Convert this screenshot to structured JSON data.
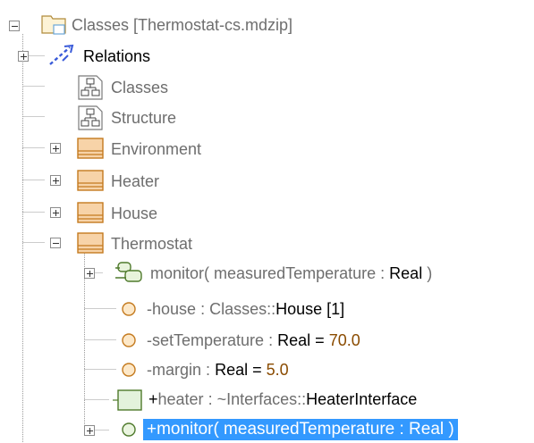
{
  "tree": {
    "root": {
      "label": "Classes [Thermostat-cs.mdzip]",
      "icon": "package-icon"
    },
    "items": [
      {
        "label": "Relations",
        "icon": "relations-icon"
      },
      {
        "label": "Classes",
        "icon": "class-diagram-icon"
      },
      {
        "label": "Structure",
        "icon": "class-diagram-icon"
      },
      {
        "label": "Environment",
        "icon": "class-icon"
      },
      {
        "label": "Heater",
        "icon": "class-icon"
      },
      {
        "label": "House",
        "icon": "class-icon"
      },
      {
        "label": "Thermostat",
        "icon": "class-icon"
      }
    ],
    "thermostat_children": {
      "monitor_op": {
        "name": "monitor(",
        "param": "measuredTemperature",
        "sep": ":",
        "type": "Real",
        "close": ")",
        "icon": "operation-icon"
      },
      "house_attr": {
        "vis": "-",
        "name": "house",
        "sep": ":",
        "type_prefix": "Classes::",
        "type": "House",
        "mult": "[1]",
        "icon": "attribute-icon"
      },
      "settemp_attr": {
        "vis": "-",
        "name": "setTemperature",
        "sep": ":",
        "type": "Real",
        "eq": "=",
        "value": "70.0",
        "icon": "attribute-icon"
      },
      "margin_attr": {
        "vis": "-",
        "name": "margin",
        "sep": ":",
        "type": "Real",
        "eq": "=",
        "value": "5.0",
        "icon": "attribute-icon"
      },
      "heater_port": {
        "vis": "+",
        "name": "heater",
        "sep": ":",
        "type_prefix": "~Interfaces::",
        "type": "HeaterInterface",
        "icon": "port-icon"
      },
      "monitor_reception": {
        "text": "+monitor( measuredTemperature : Real )",
        "icon": "reception-icon"
      }
    }
  },
  "colors": {
    "selection": "#3399ff",
    "class_fill": "#f7d3a8",
    "class_border": "#c47a1e",
    "attribute_fill": "#fde8c8",
    "value": "#8a4b00"
  }
}
